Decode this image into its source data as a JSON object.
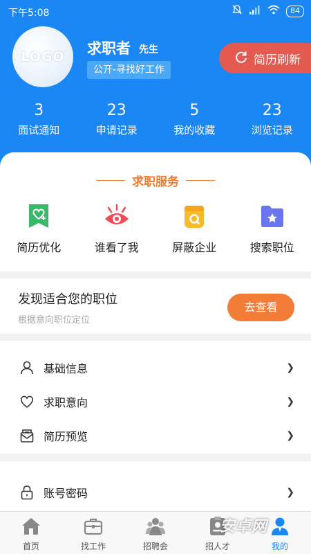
{
  "status_bar": {
    "time": "下午5:08",
    "battery": "84"
  },
  "profile": {
    "logo": "LOGO",
    "name": "求职者",
    "title": "先生",
    "status": "公开-寻找好工作",
    "refresh_label": "简历刷新"
  },
  "stats": [
    {
      "value": "3",
      "label": "面试通知"
    },
    {
      "value": "23",
      "label": "申请记录"
    },
    {
      "value": "5",
      "label": "我的收藏"
    },
    {
      "value": "23",
      "label": "浏览记录"
    }
  ],
  "services": {
    "title": "求职服务",
    "items": [
      {
        "label": "简历优化",
        "icon": "resume-heart-icon",
        "color": "#3ab86a"
      },
      {
        "label": "谁看了我",
        "icon": "eye-icon",
        "color": "#ee4b55"
      },
      {
        "label": "屏蔽企业",
        "icon": "shield-block-icon",
        "color": "#f7bb2c"
      },
      {
        "label": "搜索职位",
        "icon": "folder-star-icon",
        "color": "#6a75f0"
      }
    ]
  },
  "discover": {
    "title": "发现适合您的职位",
    "subtitle": "根据意向职位定位",
    "button": "去查看"
  },
  "menu": [
    {
      "label": "基础信息",
      "icon": "user-icon"
    },
    {
      "label": "求职意向",
      "icon": "heart-icon"
    },
    {
      "label": "简历预览",
      "icon": "envelope-icon"
    }
  ],
  "menu2": [
    {
      "label": "账号密码",
      "icon": "lock-icon"
    }
  ],
  "tabs": [
    {
      "label": "首页",
      "icon": "home-icon"
    },
    {
      "label": "找工作",
      "icon": "briefcase-icon"
    },
    {
      "label": "招聘会",
      "icon": "group-icon"
    },
    {
      "label": "招人才",
      "icon": "id-card-icon"
    },
    {
      "label": "我的",
      "icon": "profile-icon",
      "active": true
    }
  ],
  "watermark": "安卓网",
  "colors": {
    "brand_blue": "#1a87f5",
    "accent_orange": "#f37d36",
    "refresh_red": "#e45a50"
  }
}
